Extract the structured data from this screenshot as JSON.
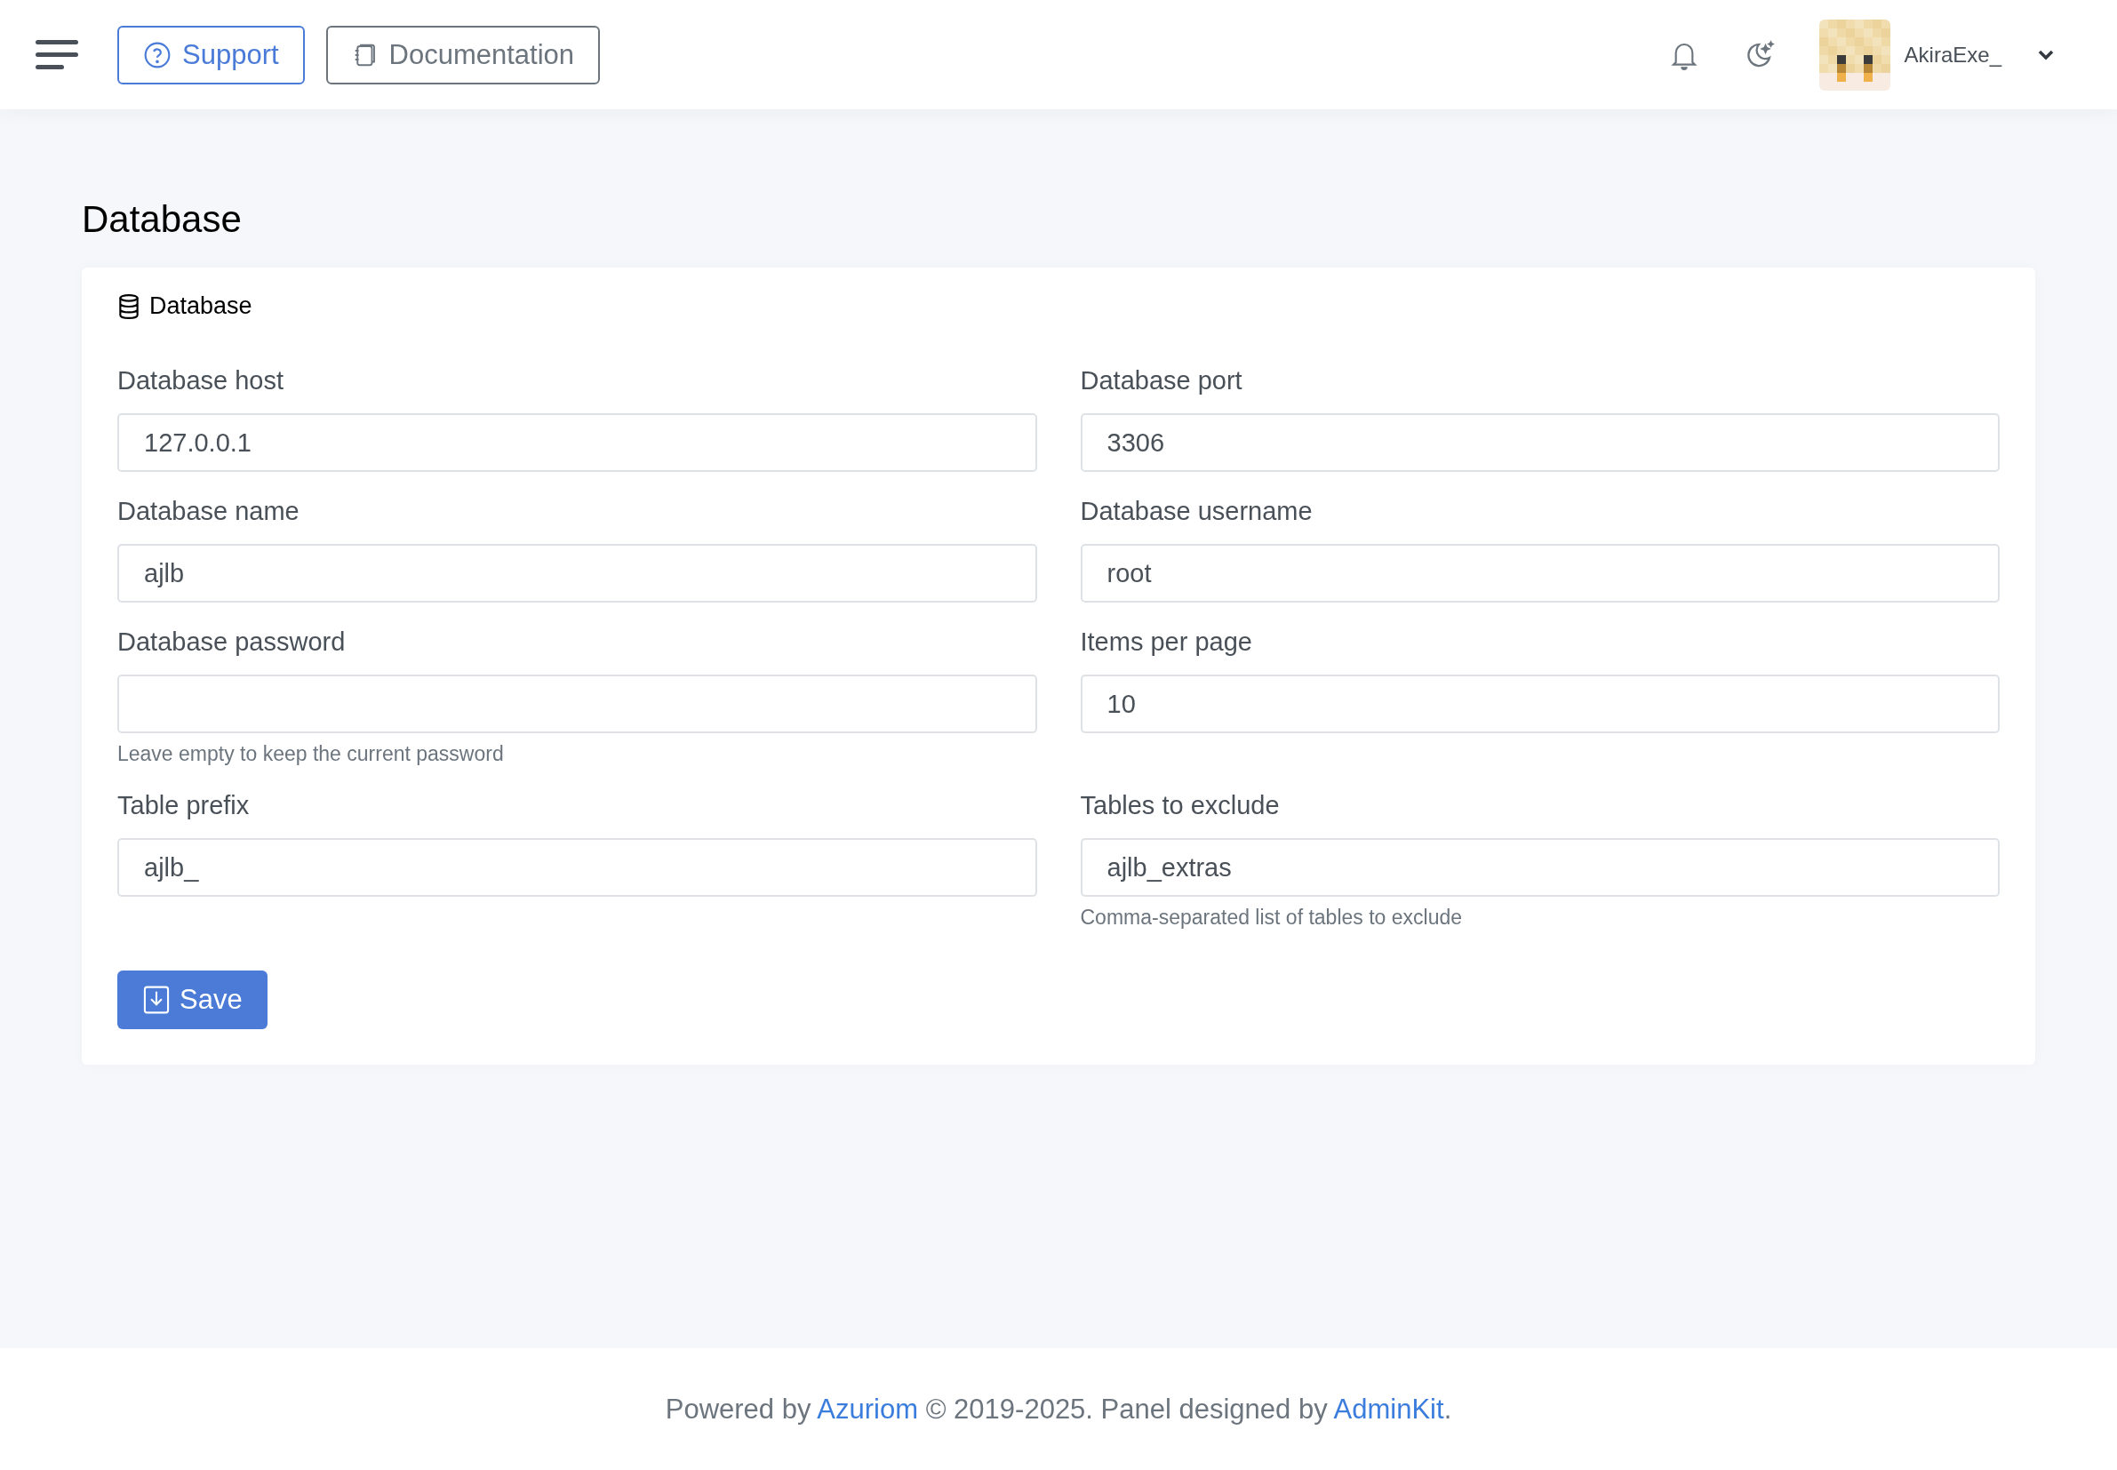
{
  "topbar": {
    "buttons": [
      {
        "kind": "support",
        "label": "Support"
      },
      {
        "kind": "docs",
        "label": "Documentation"
      }
    ],
    "user": {
      "name": "AkiraExe_"
    }
  },
  "page": {
    "title": "Database"
  },
  "card": {
    "title": "Database",
    "fields": [
      {
        "label": "Database host",
        "value": "127.0.0.1"
      },
      {
        "label": "Database port",
        "value": "3306"
      },
      {
        "label": "Database name",
        "value": "ajlb"
      },
      {
        "label": "Database username",
        "value": "root"
      },
      {
        "label": "Database password",
        "help": "Leave empty to keep the current password"
      },
      {
        "label": "Items per page",
        "value": "10"
      },
      {
        "label": "Table prefix",
        "value": "ajlb_"
      },
      {
        "label": "Tables to exclude",
        "value": "ajlb_extras",
        "help": "Comma-separated list of tables to exclude"
      }
    ],
    "save": "Save"
  },
  "footer": {
    "parts": [
      {
        "kind": "text",
        "text": "Powered by "
      },
      {
        "kind": "link",
        "text": "Azuriom"
      },
      {
        "kind": "text",
        "text": " © 2019-2025. Panel designed by "
      },
      {
        "kind": "link",
        "text": "AdminKit"
      },
      {
        "kind": "text",
        "text": "."
      }
    ]
  }
}
